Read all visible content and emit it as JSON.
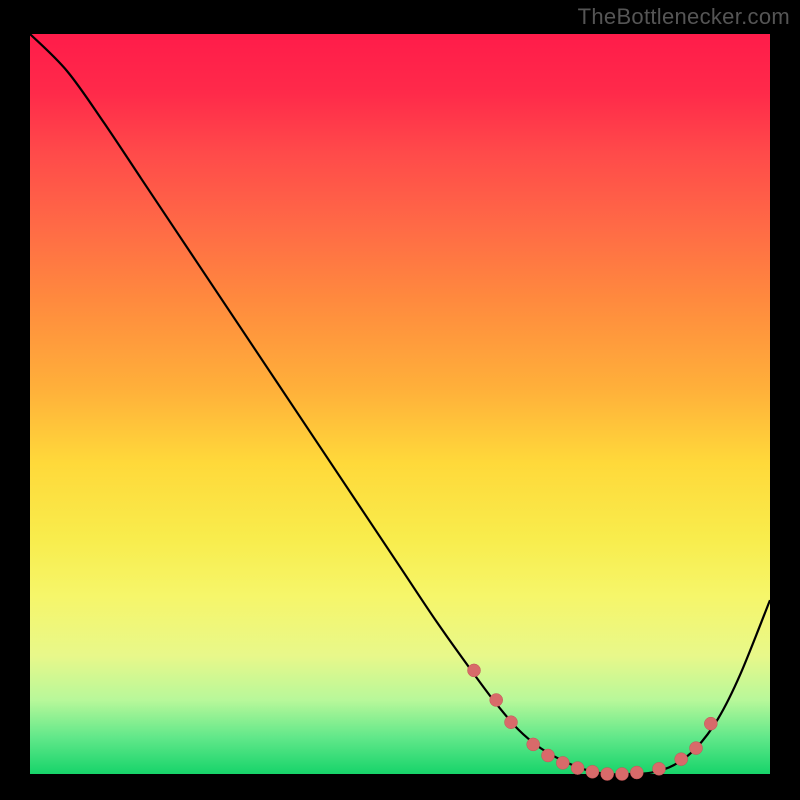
{
  "attribution": "TheBottlenecker.com",
  "colors": {
    "page_bg": "#000000",
    "curve": "#000000",
    "dot_fill": "#d86a6a",
    "dot_stroke": "#c25555",
    "gradient_top": "#ff1c4a",
    "gradient_bottom": "#17d46a"
  },
  "chart_data": {
    "type": "line",
    "title": "",
    "xlabel": "",
    "ylabel": "",
    "xlim": [
      0,
      100
    ],
    "ylim": [
      0,
      100
    ],
    "x": [
      0,
      5,
      10,
      15,
      20,
      25,
      30,
      35,
      40,
      45,
      50,
      55,
      60,
      63,
      66,
      69,
      72,
      75,
      78,
      81,
      84,
      87,
      90,
      93,
      96,
      100
    ],
    "values": [
      100,
      95,
      88,
      80.5,
      73,
      65.5,
      58,
      50.5,
      43,
      35.5,
      28,
      20.5,
      13.5,
      9.5,
      6,
      3.5,
      1.8,
      0.6,
      0,
      0,
      0.2,
      1.2,
      3.5,
      7.5,
      13.5,
      23.5
    ],
    "dots": {
      "x": [
        60,
        63,
        65,
        68,
        70,
        72,
        74,
        76,
        78,
        80,
        82,
        85,
        88,
        90,
        92
      ],
      "y": [
        14,
        10,
        7,
        4,
        2.5,
        1.5,
        0.8,
        0.3,
        0,
        0,
        0.2,
        0.7,
        2,
        3.5,
        6.8
      ]
    }
  }
}
